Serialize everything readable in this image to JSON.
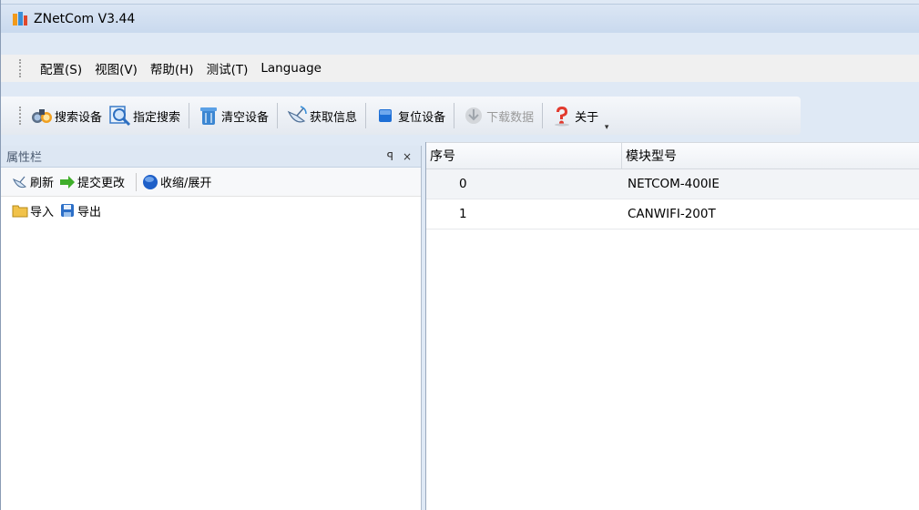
{
  "window": {
    "title": "ZNetCom V3.44"
  },
  "menu": [
    "配置(S)",
    "视图(V)",
    "帮助(H)",
    "测试(T)",
    "Language"
  ],
  "toolbar": {
    "search": "搜索设备",
    "specified_search": "指定搜索",
    "clear": "清空设备",
    "get_info": "获取信息",
    "reset": "复位设备",
    "download": "下载数据",
    "about": "关于"
  },
  "panel": {
    "title": "属性栏",
    "pin": "ꟼ",
    "close": "×",
    "refresh": "刷新",
    "submit": "提交更改",
    "collapse": "收缩/展开",
    "import": "导入",
    "export": "导出"
  },
  "grid": {
    "columns": [
      "序号",
      "模块型号"
    ],
    "rows": [
      {
        "index": "0",
        "model": "NETCOM-400IE"
      },
      {
        "index": "1",
        "model": "CANWIFI-200T"
      }
    ]
  },
  "colors": {
    "accent": "#1e6fd6",
    "titlebar": "#c9d9ee"
  }
}
